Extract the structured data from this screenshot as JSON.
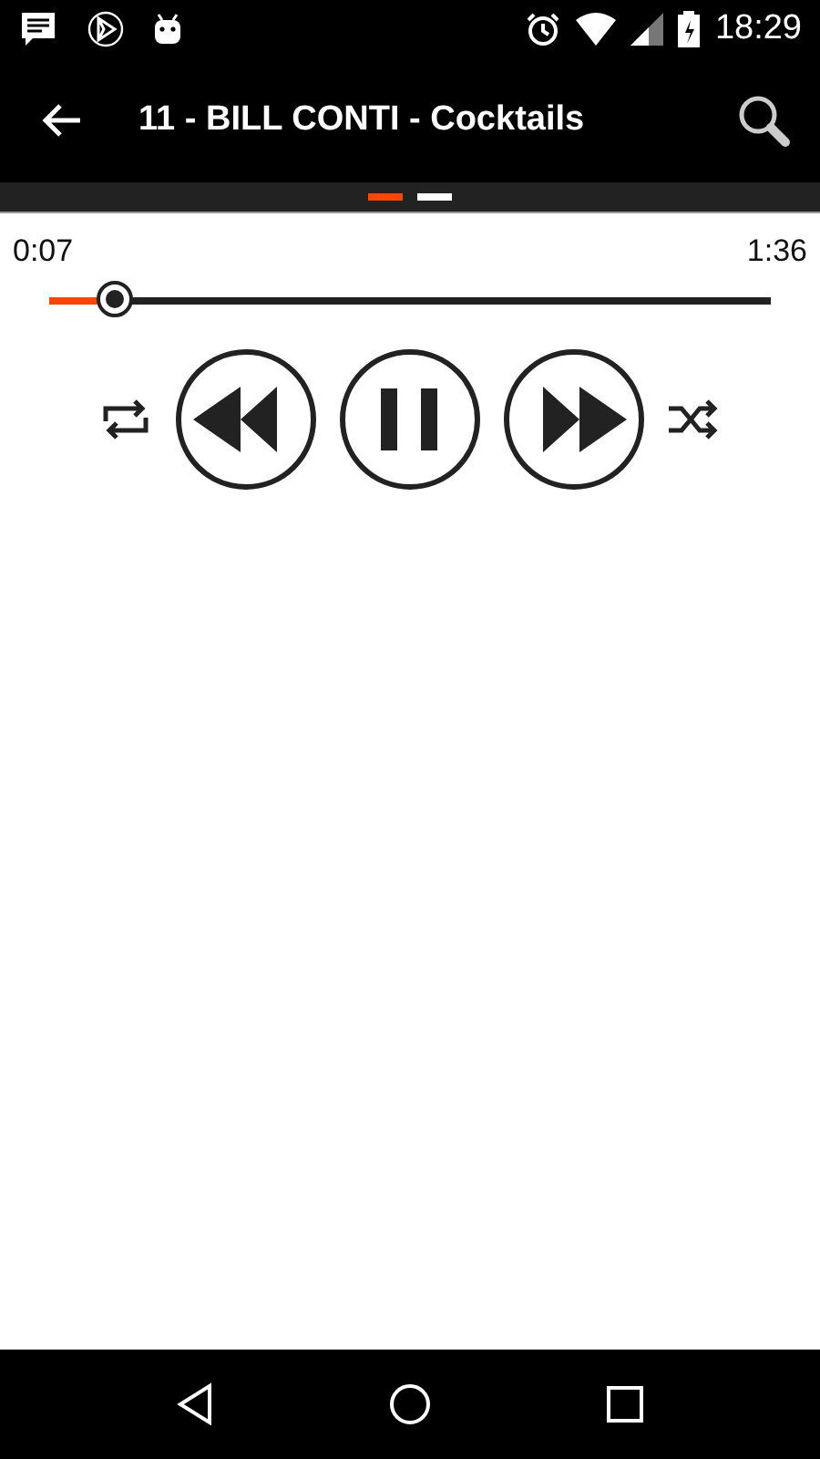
{
  "status_bar": {
    "time": "18:29"
  },
  "app_bar": {
    "title": "11 - BILL CONTI - Cocktails"
  },
  "pages": [
    {
      "selected": true
    },
    {
      "selected": false
    }
  ],
  "player": {
    "elapsed": "0:07",
    "duration": "1:36",
    "level": 0.09
  }
}
